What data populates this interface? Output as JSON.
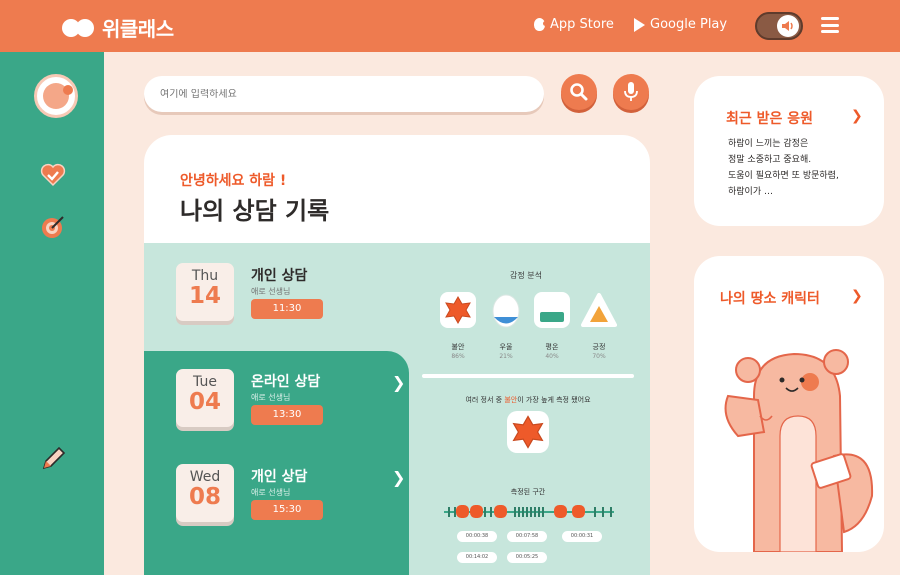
{
  "brand": {
    "logo_text": "위클래스"
  },
  "header": {
    "app_store": "App Store",
    "google_play": "Google Play",
    "sound_toggle_state": "on",
    "icons": [
      "apple-icon",
      "google-play-icon",
      "speaker-icon",
      "menu-icon"
    ]
  },
  "sidebar": {
    "items": [
      {
        "name": "avatar",
        "icon": "avatar-icon"
      },
      {
        "name": "favorites",
        "icon": "heart-check-icon"
      },
      {
        "name": "goals",
        "icon": "target-icon"
      },
      {
        "name": "write",
        "icon": "pencil-icon"
      }
    ]
  },
  "search": {
    "placeholder": "여기에 입력하세요",
    "icons": [
      "search-icon",
      "microphone-icon"
    ]
  },
  "main": {
    "greeting": "안녕하세요 하람 !",
    "title": "나의 상담 기록",
    "sessions": [
      {
        "day": "Thu",
        "date": "14",
        "type": "개인 상담",
        "teacher": "애로 선생님",
        "time": "11:30"
      },
      {
        "day": "Tue",
        "date": "04",
        "type": "온라인 상담",
        "teacher": "애로 선생님",
        "time": "13:30"
      },
      {
        "day": "Wed",
        "date": "08",
        "type": "개인 상담",
        "teacher": "애로 선생님",
        "time": "15:30"
      }
    ],
    "emotion": {
      "title": "감정 분석",
      "items": [
        {
          "name": "불안",
          "percent": "86%",
          "color": "#ee5a2a"
        },
        {
          "name": "우울",
          "percent": "21%",
          "color": "#3f8fd6"
        },
        {
          "name": "평온",
          "percent": "40%",
          "color": "#3aa788"
        },
        {
          "name": "긍정",
          "percent": "70%",
          "color": "#f2a33a"
        }
      ],
      "result_prefix": "여러 정서 중 ",
      "result_highlight": "불안",
      "result_suffix": "이 가장 높게 측정 됐어요",
      "range_label": "측정된 구간",
      "timestamps": [
        "00:00:38",
        "00:07:58",
        "00:00:31",
        "00:14:02",
        "00:05:25"
      ]
    }
  },
  "right": {
    "cheer": {
      "title": "최근 받은 응원",
      "lines": [
        "하람이 느끼는 감정은",
        "정말 소중하고 중요해.",
        "도움이 필요하면 또 방문하렴,",
        "하람이가 …"
      ]
    },
    "character": {
      "title": "나의 땅소 캐릭터"
    }
  },
  "colors": {
    "accent": "#ee7b4f",
    "teal": "#3aa788",
    "mint": "#c7e6dc",
    "cream": "#fbe9df"
  }
}
